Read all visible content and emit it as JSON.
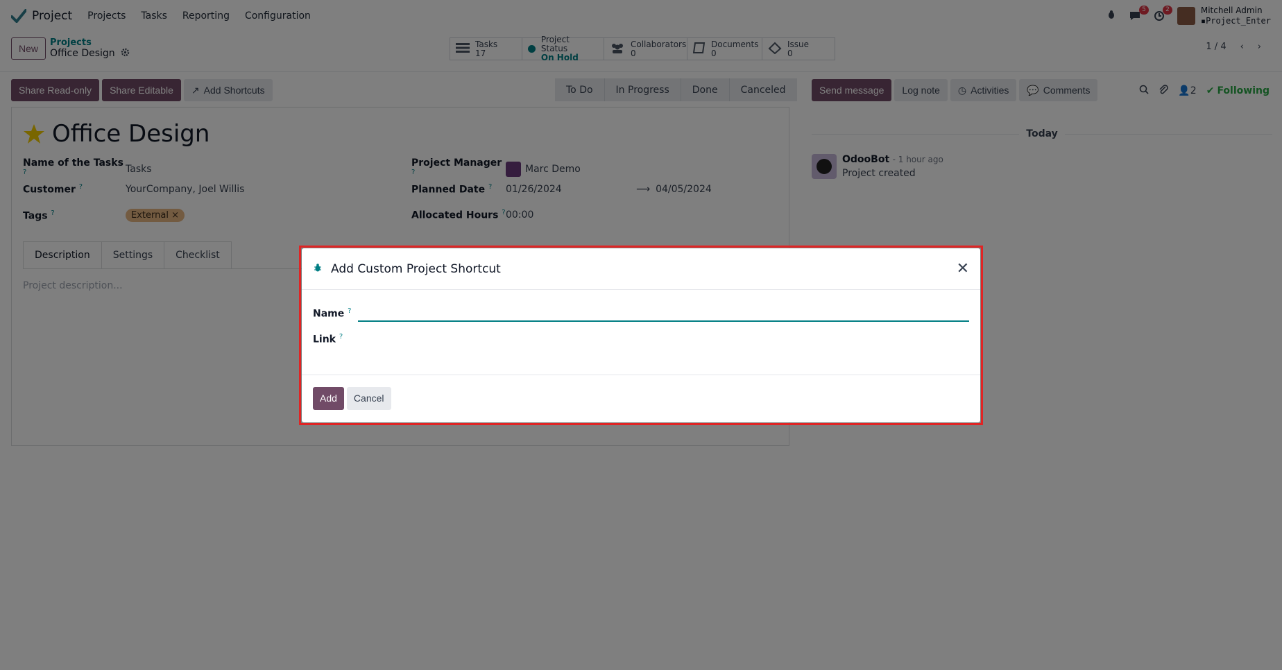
{
  "navbar": {
    "app_name": "Project",
    "menu": [
      "Projects",
      "Tasks",
      "Reporting",
      "Configuration"
    ],
    "discuss_count": "5",
    "activity_count": "2",
    "user_name": "Mitchell Admin",
    "database": "Project_Enter"
  },
  "control_panel": {
    "new_label": "New",
    "breadcrumb_parent": "Projects",
    "breadcrumb_current": "Office Design",
    "smart_buttons": [
      {
        "label": "Tasks",
        "value": "17"
      },
      {
        "label": "Project Status",
        "value": "On Hold"
      },
      {
        "label": "Collaborators",
        "value": "0"
      },
      {
        "label": "Documents",
        "value": "0"
      },
      {
        "label": "Issue",
        "value": "0"
      }
    ],
    "pager": "1 / 4"
  },
  "action_bar": {
    "share_readonly": "Share Read-only",
    "share_editable": "Share Editable",
    "add_shortcuts": "Add Shortcuts",
    "stages": [
      "To Do",
      "In Progress",
      "Done",
      "Canceled"
    ]
  },
  "form": {
    "title": "Office Design",
    "fields": {
      "name_of_tasks_label": "Name of the Tasks",
      "name_of_tasks_value": "Tasks",
      "customer_label": "Customer",
      "customer_value": "YourCompany, Joel Willis",
      "tags_label": "Tags",
      "tag_value": "External",
      "pm_label": "Project Manager",
      "pm_value": "Marc Demo",
      "planned_label": "Planned Date",
      "planned_start": "01/26/2024",
      "planned_end": "04/05/2024",
      "hours_label": "Allocated Hours",
      "hours_value": "00:00"
    },
    "tabs": [
      "Description",
      "Settings",
      "Checklist"
    ],
    "description_placeholder": "Project description..."
  },
  "chatter": {
    "send_message": "Send message",
    "log_note": "Log note",
    "activities": "Activities",
    "comments": "Comments",
    "followers_count": "2",
    "following": "Following",
    "today": "Today",
    "author": "OdooBot",
    "time": "- 1 hour ago",
    "body": "Project created"
  },
  "dialog": {
    "title": "Add Custom Project Shortcut",
    "name_label": "Name",
    "link_label": "Link",
    "name_value": "",
    "add_label": "Add",
    "cancel_label": "Cancel"
  },
  "colors": {
    "primary": "#714b67",
    "accent": "#017e84",
    "highlight": "#e02424"
  }
}
